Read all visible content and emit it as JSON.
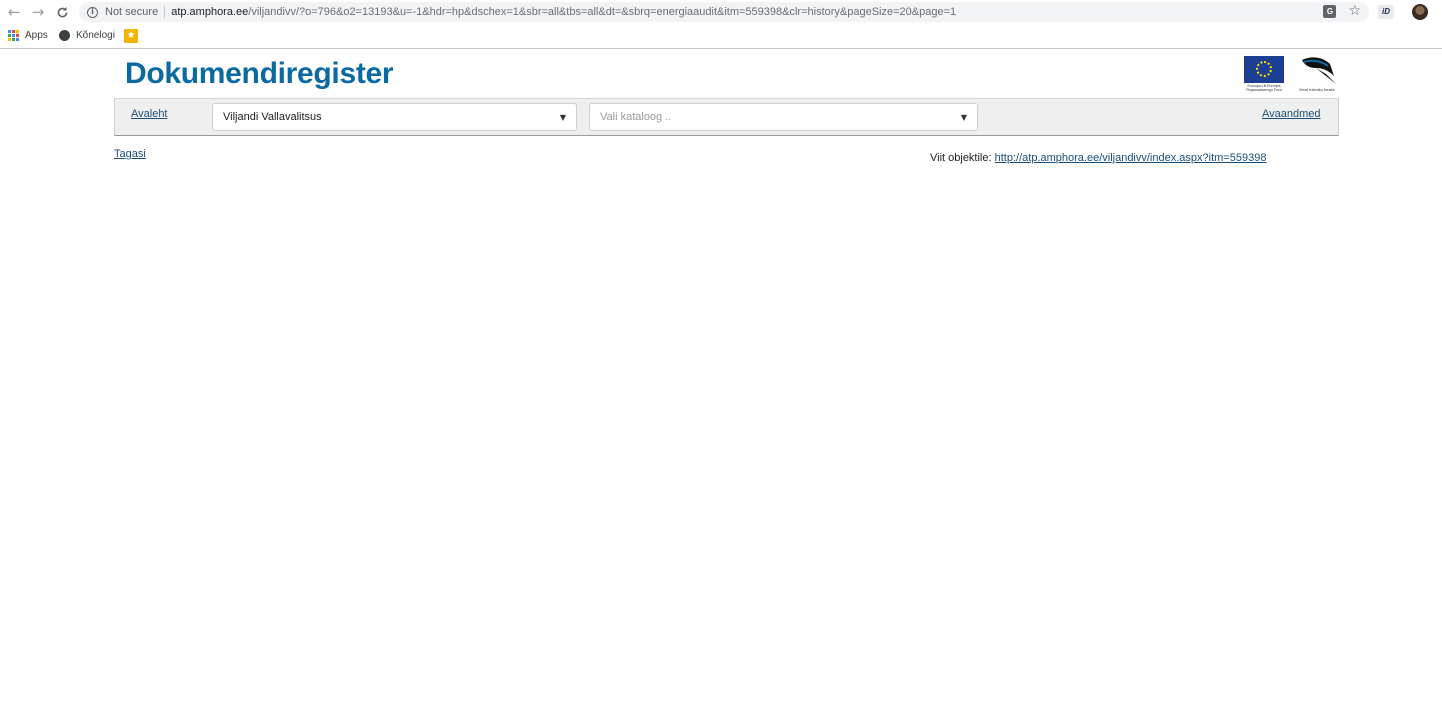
{
  "browser": {
    "security_label": "Not secure",
    "url_host": "atp.amphora.ee",
    "url_rest": "/viljandivv/?o=796&o2=13193&u=-1&hdr=hp&dschex=1&sbr=all&tbs=all&dt=&sbrq=energiaaudit&itm=559398&clr=history&pageSize=20&page=1",
    "extension_label": "iD",
    "bookmarks": [
      {
        "label": "Apps",
        "icon": "apps-grid-icon"
      },
      {
        "label": "Kõnelogi",
        "icon": "globe-icon"
      },
      {
        "label": "",
        "icon": "star-bookmark-icon"
      }
    ]
  },
  "page": {
    "title": "Dokumendiregister",
    "logos": {
      "eu_caption": "Euroopa Liit Euroopa Regionaalarengu Fond",
      "ee_caption": "Eesti tuleviku heaks"
    },
    "nav": {
      "home_link": "Avaleht",
      "organization_select": {
        "value": "Viljandi Vallavalitsus"
      },
      "catalog_select": {
        "placeholder": "Vali kataloog .."
      },
      "open_data_link": "Avaandmed"
    },
    "back_link": "Tagasi",
    "object_link_label": "Viit objektile:",
    "object_link_url": "http://atp.amphora.ee/viljandivv/index.aspx?itm=559398"
  },
  "colors": {
    "title_blue": "#0a6aa1",
    "link_blue": "#1a4f7a",
    "navbar_bg": "#efefef",
    "eu_blue": "#1c3f94",
    "eu_yellow": "#ffdd00"
  }
}
